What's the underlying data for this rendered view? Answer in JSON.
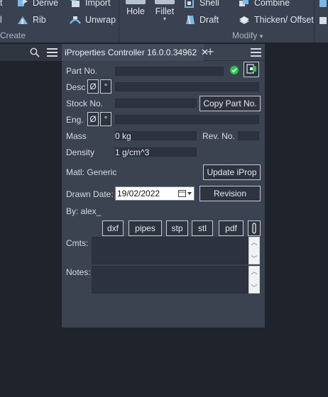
{
  "ribbon": {
    "derive": "Derive",
    "import": "Import",
    "rib": "Rib",
    "unwrap": "Unwrap",
    "hole": "Hole",
    "fillet": "Fillet",
    "shell": "Shell",
    "draft": "Draft",
    "combine": "Combine",
    "thicken_offset": "Thicken/ Offset",
    "create_label": "Create",
    "modify_label": "Modify",
    "modify_caret": "▾",
    "fillet_caret": "▾"
  },
  "tab": {
    "title": "iProperties Controller  16.0.0.34962",
    "close": "✕",
    "add": "+"
  },
  "form": {
    "part_no_label": "Part No.",
    "desc_label": "Desc",
    "stock_no_label": "Stock No.",
    "eng_label": "Eng.",
    "mass_label": "Mass",
    "mass_value": "0 kg",
    "rev_no_label": "Rev. No.",
    "density_label": "Density",
    "density_value": "1 g/cm^3",
    "matl_label": "Matl: Generic",
    "drawn_date_label": "Drawn Date:",
    "drawn_date_value": "19/02/2022",
    "by_label": "By: alex_",
    "cmts_label": "Cmts:",
    "notes_label": "Notes:",
    "diameter_symbol": "Ø",
    "degree_symbol": "°"
  },
  "buttons": {
    "copy_part_no": "Copy Part No.",
    "update_iprop": "Update iProp",
    "revision": "Revision",
    "dxf": "dxf",
    "pipes": "pipes",
    "stp": "stp",
    "stl": "stl",
    "pdf": "pdf"
  },
  "colors": {
    "ribbon_bg": "#3a4150",
    "panel_bg": "#3b4250",
    "field_bg": "#2d333e",
    "check_green": "#28c24b"
  },
  "icons": [
    "derive-icon",
    "import-icon",
    "rib-icon",
    "unwrap-icon",
    "hole-icon",
    "fillet-icon",
    "shell-icon",
    "draft-icon",
    "combine-icon",
    "thicken-icon",
    "search-icon",
    "menu-icon",
    "close-icon",
    "add-tab-icon",
    "check-icon",
    "part-icon",
    "calendar-icon",
    "paperclip-icon"
  ]
}
